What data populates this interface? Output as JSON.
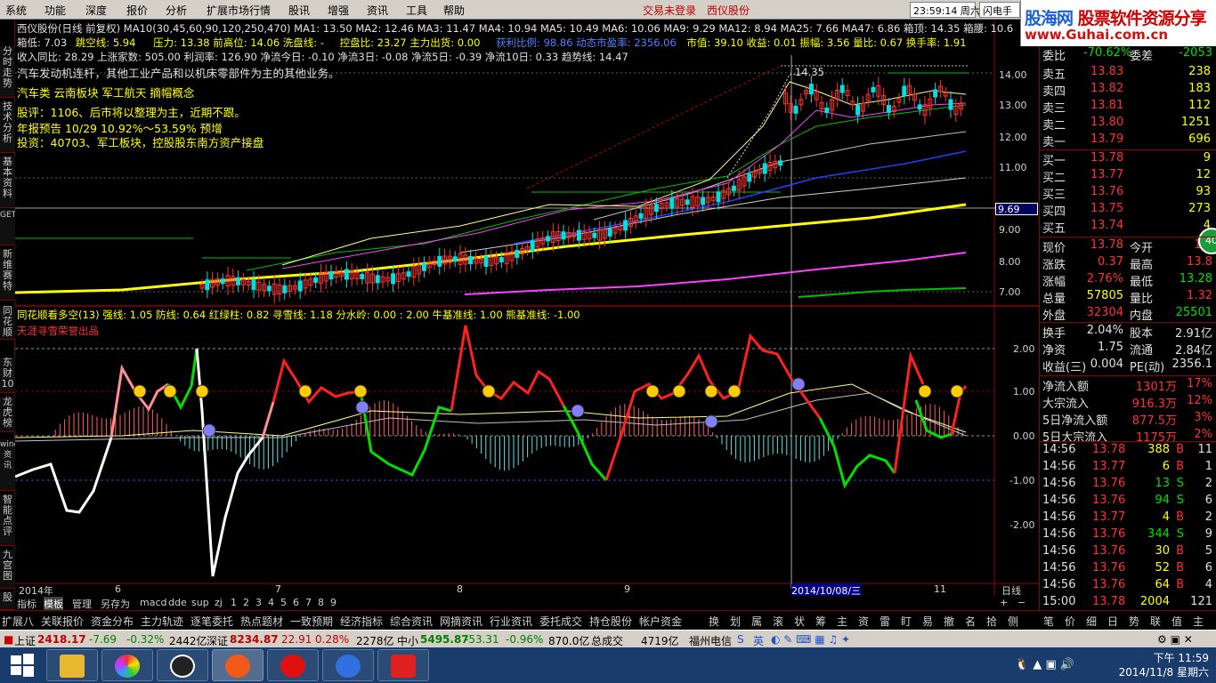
{
  "menu": [
    "系统",
    "功能",
    "深度",
    "报价",
    "分析",
    "扩展市场行情",
    "股讯",
    "增强",
    "资讯",
    "工具",
    "帮助"
  ],
  "login_status": "交易未登录",
  "stock_name_top": "西仪股份",
  "clock_box": "23:59:14 周六",
  "flash_label": "闪电手",
  "logo": {
    "main": "股海网",
    "tag": "股票软件资源分享",
    "url": "www.Guhai.com.cn"
  },
  "left_nav": [
    "分时走势",
    "技术分析",
    "基本资料",
    "GET",
    "新维赛特",
    "同花顺",
    "东财10",
    "龙虎榜",
    "wind资讯",
    "智能点评",
    "九宫图",
    "股"
  ],
  "info": {
    "line1": "西仪股份(日线 前复权) MA10(30,45,60,90,120,250,470) MA1: 13.50 MA2: 12.46 MA3: 11.47 MA4: 10.94 MA5: 10.49 MA6: 10.06 MA9: 9.29 MA12: 8.94 MA25: 7.66 MA47: 6.86 箱顶: 14.35 箱腰: 10.6",
    "line2a": "箱低: 7.03",
    "line2b": "跳空线: 5.94",
    "line2c": "压力: 13.38 前高位: 14.06 洗盘线: -",
    "line2d": "控盘比: 23.27 主力出货: 0.00",
    "line2e": "获利比例: 98.86 动态市盈率: 2356.06",
    "line2f": "市值: 39.10 收益: 0.01 振幅: 3.56 量比: 0.67 换手率: 1.91",
    "line3": "收入同比: 28.29 上涨家数: 505.00 利润率: 126.90 净流今日: -0.10 净流3日: -0.08 净流5日: -0.39 净流10日: 0.33 趋势线: 14.47",
    "industry": "汽车发动机连杆，其他工业产品和以机床零部件为主的其他业务。",
    "concept": "汽车类 云南板块 军工航天 摘帽概念",
    "review": "股评：1106、后市将以整理为主，近期不跟。",
    "forecast": "年报预告  10/29 10.92%～53.59% 预增",
    "invest": "投资：40703、军工板块，控股股东南方资产接盘",
    "peak_label": "14.35",
    "price_tag": "9.69"
  },
  "price_axis": [
    "14.00",
    "13.00",
    "12.00",
    "11.00",
    "9.00",
    "8.00",
    "7.00"
  ],
  "indicator": {
    "title": "同花顺看多空(13) 强线: 1.05 防线: 0.64 红绿柱: 0.82 寻雪线: 1.18 分水岭: 0.00 : 2.00 牛基准线: 1.00 熊基准线: -1.00",
    "credit": "天涯寻雪荣誉出品",
    "axis": [
      "2.00",
      "1.00",
      "0.00",
      "-1.00",
      "-2.00"
    ]
  },
  "date_axis": [
    "2014年",
    "6",
    "7",
    "8",
    "9",
    "2014/10/08/三",
    "11",
    "日线"
  ],
  "sub_tabs": [
    "指标",
    "模板",
    "管理",
    "另存为",
    "macd",
    "dde",
    "sup",
    "zj",
    "1",
    "2",
    "3",
    "4",
    "5",
    "6",
    "7",
    "8",
    "9"
  ],
  "quote": {
    "header": {
      "l1": "委比",
      "v1": "-70.62%",
      "l2": "委差",
      "v2": "-2053"
    },
    "asks": [
      {
        "label": "卖五",
        "price": "13.83",
        "vol": "238"
      },
      {
        "label": "卖四",
        "price": "13.82",
        "vol": "183"
      },
      {
        "label": "卖三",
        "price": "13.81",
        "vol": "112"
      },
      {
        "label": "卖二",
        "price": "13.80",
        "vol": "1251"
      },
      {
        "label": "卖一",
        "price": "13.79",
        "vol": "696"
      }
    ],
    "bids": [
      {
        "label": "买一",
        "price": "13.78",
        "vol": "9"
      },
      {
        "label": "买二",
        "price": "13.77",
        "vol": "12"
      },
      {
        "label": "买三",
        "price": "13.76",
        "vol": "93"
      },
      {
        "label": "买四",
        "price": "13.75",
        "vol": "273"
      },
      {
        "label": "买五",
        "price": "13.74",
        "vol": "4"
      }
    ],
    "stats": [
      {
        "l1": "现价",
        "v1": "13.78",
        "l2": "今开",
        "v2": "13."
      },
      {
        "l1": "涨跌",
        "v1": "0.37",
        "l2": "最高",
        "v2": "13.8"
      },
      {
        "l1": "涨幅",
        "v1": "2.76%",
        "l2": "最低",
        "v2": "13.28"
      },
      {
        "l1": "总量",
        "v1": "57805",
        "l2": "量比",
        "v2": "1.32"
      },
      {
        "l1": "外盘",
        "v1": "32304",
        "l2": "内盘",
        "v2": "25501"
      }
    ],
    "stats2": [
      {
        "l1": "换手",
        "v1": "2.04%",
        "l2": "股本",
        "v2": "2.91亿"
      },
      {
        "l1": "净资",
        "v1": "1.75",
        "l2": "流通",
        "v2": "2.84亿"
      },
      {
        "l1": "收益(三)",
        "v1": "0.004",
        "l2": "PE(动)",
        "v2": "2356.1"
      }
    ],
    "flows": [
      {
        "l": "净流入额",
        "v": "1301万",
        "p": "17%"
      },
      {
        "l": "大宗流入",
        "v": "916.3万",
        "p": "12%"
      },
      {
        "l": "5日净流入额",
        "v": "877.5万",
        "p": "3%"
      },
      {
        "l": "5日大宗流入",
        "v": "1175万",
        "p": "2%"
      }
    ],
    "ticks": [
      {
        "t": "14:56",
        "p": "13.78",
        "v": "388",
        "s": "B",
        "n": "11"
      },
      {
        "t": "14:56",
        "p": "13.77",
        "v": "6",
        "s": "B",
        "n": "1"
      },
      {
        "t": "14:56",
        "p": "13.76",
        "v": "13",
        "s": "S",
        "n": "2"
      },
      {
        "t": "14:56",
        "p": "13.76",
        "v": "94",
        "s": "S",
        "n": "6"
      },
      {
        "t": "14:56",
        "p": "13.77",
        "v": "4",
        "s": "B",
        "n": "2"
      },
      {
        "t": "14:56",
        "p": "13.76",
        "v": "344",
        "s": "S",
        "n": "9"
      },
      {
        "t": "14:56",
        "p": "13.76",
        "v": "30",
        "s": "B",
        "n": "5"
      },
      {
        "t": "14:56",
        "p": "13.76",
        "v": "52",
        "s": "B",
        "n": "6"
      },
      {
        "t": "14:56",
        "p": "13.76",
        "v": "64",
        "s": "B",
        "n": "4"
      },
      {
        "t": "15:00",
        "p": "13.78",
        "v": "2004",
        "s": "",
        "n": "121"
      }
    ],
    "round_btn": "40"
  },
  "bottom_tabs": [
    "扩展八",
    "关联报价",
    "资金分布",
    "主力轨迹",
    "逐笔委托",
    "热点题材",
    "一致预期",
    "经济指标",
    "综合资讯",
    "网摘资讯",
    "行业资讯",
    "委托成交",
    "持仓股份",
    "帐户资金"
  ],
  "bottom_tools": [
    "换",
    "划",
    "属",
    "滚",
    "状",
    "筹",
    "主",
    "资",
    "雷",
    "盯",
    "易",
    "撤",
    "名",
    "拾",
    "侧"
  ],
  "right_tools": [
    "笔",
    "价",
    "细",
    "日",
    "势",
    "联",
    "值",
    "主"
  ],
  "status": {
    "sh_label": "上证",
    "sh": "2418.17",
    "sh_chg": "-7.69",
    "sh_pct": "-0.32%",
    "sh_amt": "2442亿",
    "sz_label": "深证",
    "sz": "8234.87",
    "sz_chg": "22.91",
    "sz_pct": "0.28%",
    "sz_amt": "2278亿",
    "zx_label": "中小",
    "zx": "5495.87",
    "zx_chg": "-53.31",
    "zx_pct": "-0.96%",
    "zx_amt": "870.0亿",
    "total_label": "总成交",
    "total": "4719亿",
    "isp": "福州电信",
    "ime": "英"
  },
  "taskbar": {
    "time": "下午 11:59",
    "date": "2014/11/8 星期六"
  },
  "colors": {
    "up": "#ff3030",
    "down": "#00e0e0",
    "ma_yellow": "#ffff00",
    "ma_magenta": "#ff40ff",
    "ma_blue": "#2040ff"
  }
}
